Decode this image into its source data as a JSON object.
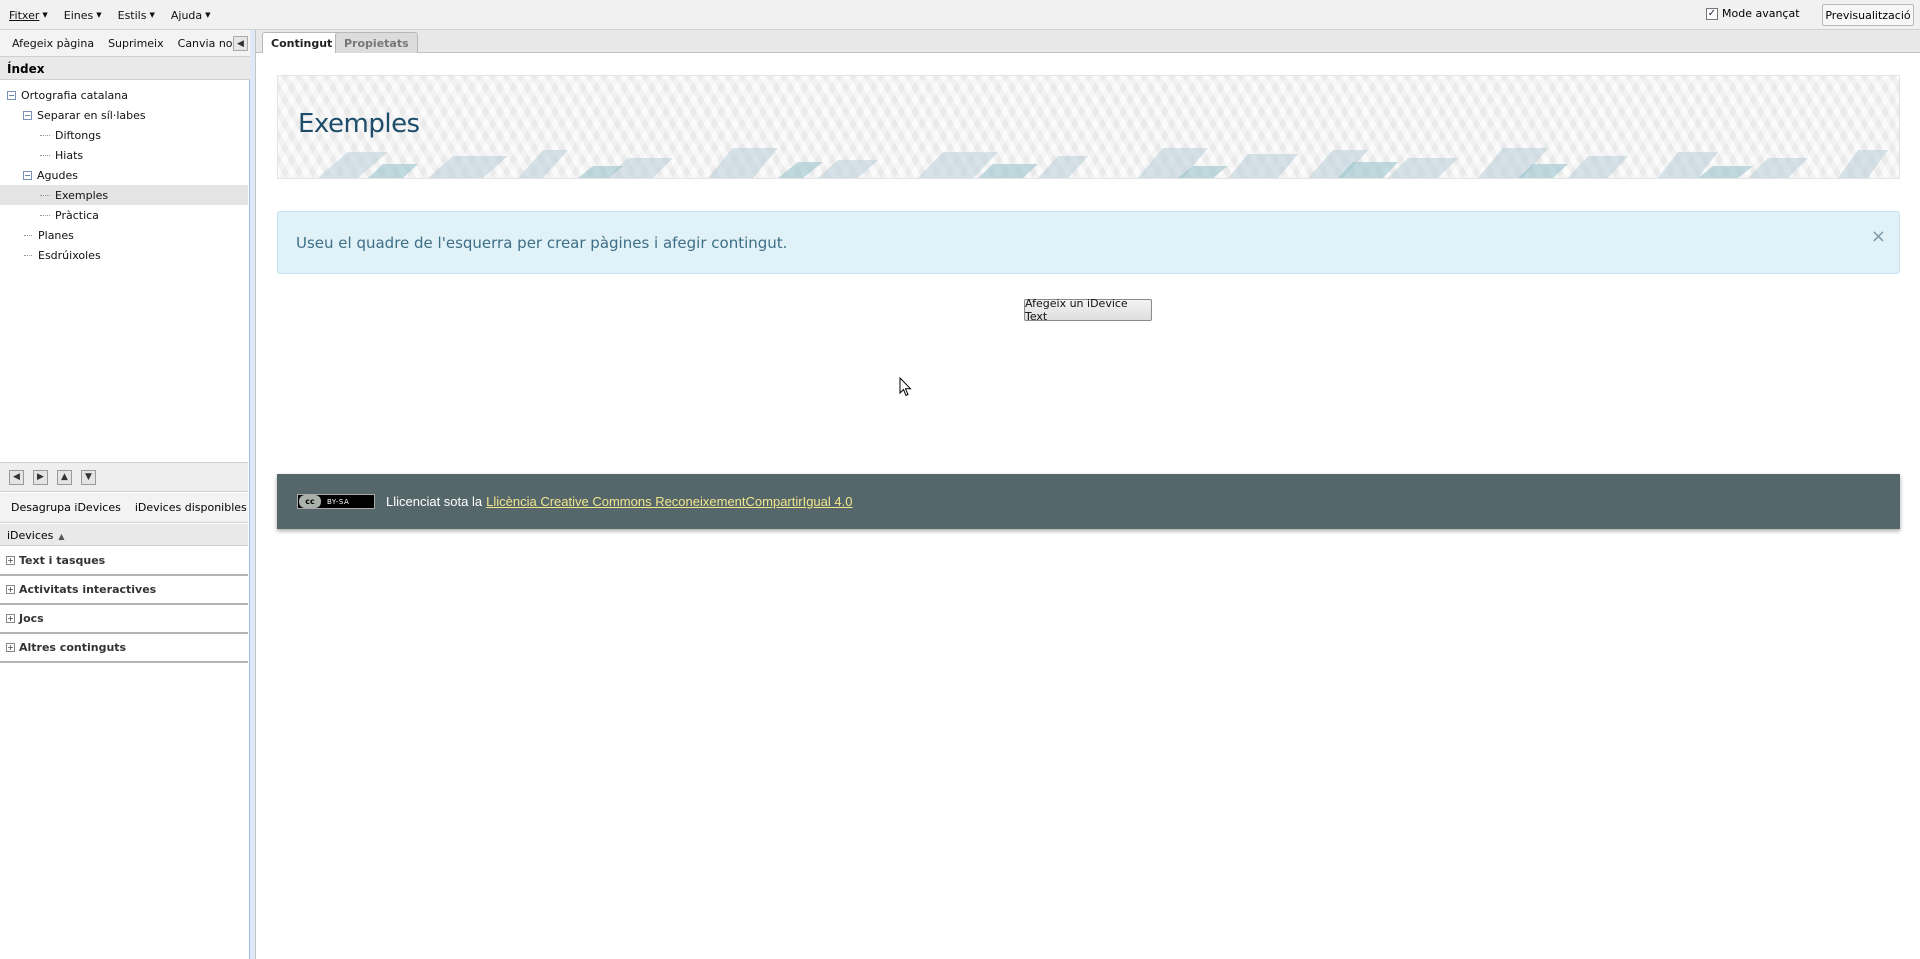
{
  "menubar": {
    "menus": [
      "Fitxer",
      "Eines",
      "Estils",
      "Ajuda"
    ],
    "advanced_mode_label": "Mode avançat",
    "advanced_mode_checked": true,
    "preview_label": "Previsualització"
  },
  "left_toolbar": {
    "add_page": "Afegeix pàgina",
    "delete": "Suprimeix",
    "rename": "Canvia nom"
  },
  "index": {
    "title": "Índex",
    "nodes": [
      {
        "label": "Ortografia catalana",
        "expander": "⊟"
      },
      {
        "label": "Separar en síl·labes",
        "expander": "⊟"
      },
      {
        "label": "Diftongs"
      },
      {
        "label": "Hiats"
      },
      {
        "label": "Agudes",
        "expander": "⊟"
      },
      {
        "label": "Exemples",
        "selected": true
      },
      {
        "label": "Pràctica"
      },
      {
        "label": "Planes"
      },
      {
        "label": "Esdrúixoles"
      }
    ]
  },
  "idevices_toolbar": {
    "ungroup": "Desagrupa iDevices",
    "available": "iDevices disponibles"
  },
  "idevices": {
    "header": "iDevices",
    "categories": [
      "Text i tasques",
      "Activitats interactives",
      "Jocs",
      "Altres continguts"
    ]
  },
  "tabs": {
    "content": "Contingut",
    "properties": "Propietats"
  },
  "page": {
    "title": "Exemples",
    "alert_text": "Useu el quadre de l'esquerra per crear pàgines i afegir contingut.",
    "add_idevice_label": "Afegeix un iDevice Text"
  },
  "footer": {
    "license_prefix": "Llicenciat sota la",
    "license_link": "Llicència Creative Commons ReconeixementCompartirIgual 4.0",
    "cc_badge_left": "cc",
    "cc_badge_right": "BY-SA"
  },
  "colors": {
    "banner_title": "#1e4d6b",
    "alert_bg": "#e0f1f7",
    "footer_bg": "#56676b",
    "link": "#f0e68c"
  }
}
